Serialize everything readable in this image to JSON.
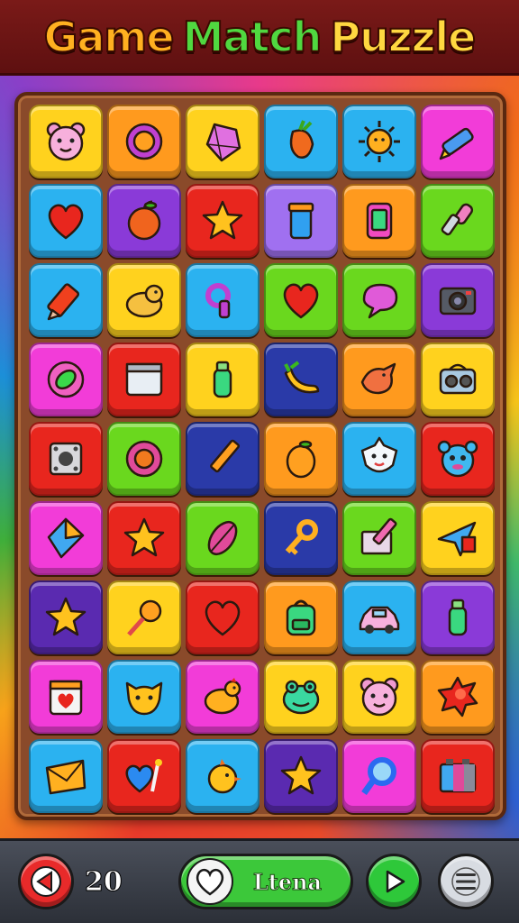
{
  "header": {
    "title_words": [
      "Game",
      "Match",
      "Puzzle"
    ]
  },
  "colors": {
    "title_game": "#ffb020",
    "title_match": "#50d840",
    "title_puzzle": "#ffd840",
    "board_frame": "#8a4a2a"
  },
  "board": {
    "rows": [
      [
        {
          "color": "yellow",
          "icon": "bear-face-icon"
        },
        {
          "color": "orange",
          "icon": "gear-icon"
        },
        {
          "color": "yellow",
          "icon": "crystal-gem-icon"
        },
        {
          "color": "blue",
          "icon": "carrot-icon"
        },
        {
          "color": "blue",
          "icon": "sun-icon"
        },
        {
          "color": "pink",
          "icon": "marker-pen-icon"
        }
      ],
      [
        {
          "color": "blue",
          "icon": "heart-icon"
        },
        {
          "color": "purple",
          "icon": "apple-icon"
        },
        {
          "color": "red",
          "icon": "star-icon"
        },
        {
          "color": "lpurple",
          "icon": "jar-icon"
        },
        {
          "color": "orange",
          "icon": "phone-icon"
        },
        {
          "color": "green",
          "icon": "paintbrush-icon"
        }
      ],
      [
        {
          "color": "blue",
          "icon": "crayon-icon"
        },
        {
          "color": "yellow",
          "icon": "dog-icon"
        },
        {
          "color": "blue",
          "icon": "whistle-icon"
        },
        {
          "color": "green",
          "icon": "heart-icon"
        },
        {
          "color": "green",
          "icon": "speech-bubble-icon"
        },
        {
          "color": "purple",
          "icon": "camera-icon"
        }
      ],
      [
        {
          "color": "pink",
          "icon": "leaf-badge-icon"
        },
        {
          "color": "red",
          "icon": "calendar-icon"
        },
        {
          "color": "yellow",
          "icon": "bottle-icon"
        },
        {
          "color": "navy",
          "icon": "banana-icon"
        },
        {
          "color": "orange",
          "icon": "bird-icon"
        },
        {
          "color": "yellow",
          "icon": "radio-icon"
        }
      ],
      [
        {
          "color": "red",
          "icon": "speaker-icon"
        },
        {
          "color": "green",
          "icon": "flower-gear-icon"
        },
        {
          "color": "navy",
          "icon": "pencil-icon"
        },
        {
          "color": "orange",
          "icon": "orange-fruit-icon"
        },
        {
          "color": "blue",
          "icon": "star-face-icon"
        },
        {
          "color": "red",
          "icon": "monster-face-icon"
        }
      ],
      [
        {
          "color": "pink",
          "icon": "kite-icon"
        },
        {
          "color": "red",
          "icon": "star-icon"
        },
        {
          "color": "green",
          "icon": "leaf-icon"
        },
        {
          "color": "navy",
          "icon": "key-icon"
        },
        {
          "color": "green",
          "icon": "envelope-pencil-icon"
        },
        {
          "color": "yellow",
          "icon": "paper-plane-icon"
        }
      ],
      [
        {
          "color": "dpurple",
          "icon": "star-icon"
        },
        {
          "color": "yellow",
          "icon": "lollipop-icon"
        },
        {
          "color": "red",
          "icon": "heart-icon"
        },
        {
          "color": "orange",
          "icon": "backpack-icon"
        },
        {
          "color": "blue",
          "icon": "car-icon"
        },
        {
          "color": "purple",
          "icon": "bottle-icon"
        }
      ],
      [
        {
          "color": "pink",
          "icon": "calendar-heart-icon"
        },
        {
          "color": "blue",
          "icon": "cat-face-icon"
        },
        {
          "color": "pink",
          "icon": "chicken-icon"
        },
        {
          "color": "yellow",
          "icon": "frog-face-icon"
        },
        {
          "color": "yellow",
          "icon": "bear-face-icon"
        },
        {
          "color": "orange",
          "icon": "splat-icon"
        }
      ],
      [
        {
          "color": "blue",
          "icon": "envelope-icon"
        },
        {
          "color": "red",
          "icon": "heart-wand-icon"
        },
        {
          "color": "blue",
          "icon": "chick-icon"
        },
        {
          "color": "dpurple",
          "icon": "star-icon"
        },
        {
          "color": "pink",
          "icon": "magnifier-icon"
        },
        {
          "color": "red",
          "icon": "battery-icon"
        }
      ]
    ]
  },
  "footer": {
    "score": "20",
    "main_button_label": "Ltena"
  }
}
